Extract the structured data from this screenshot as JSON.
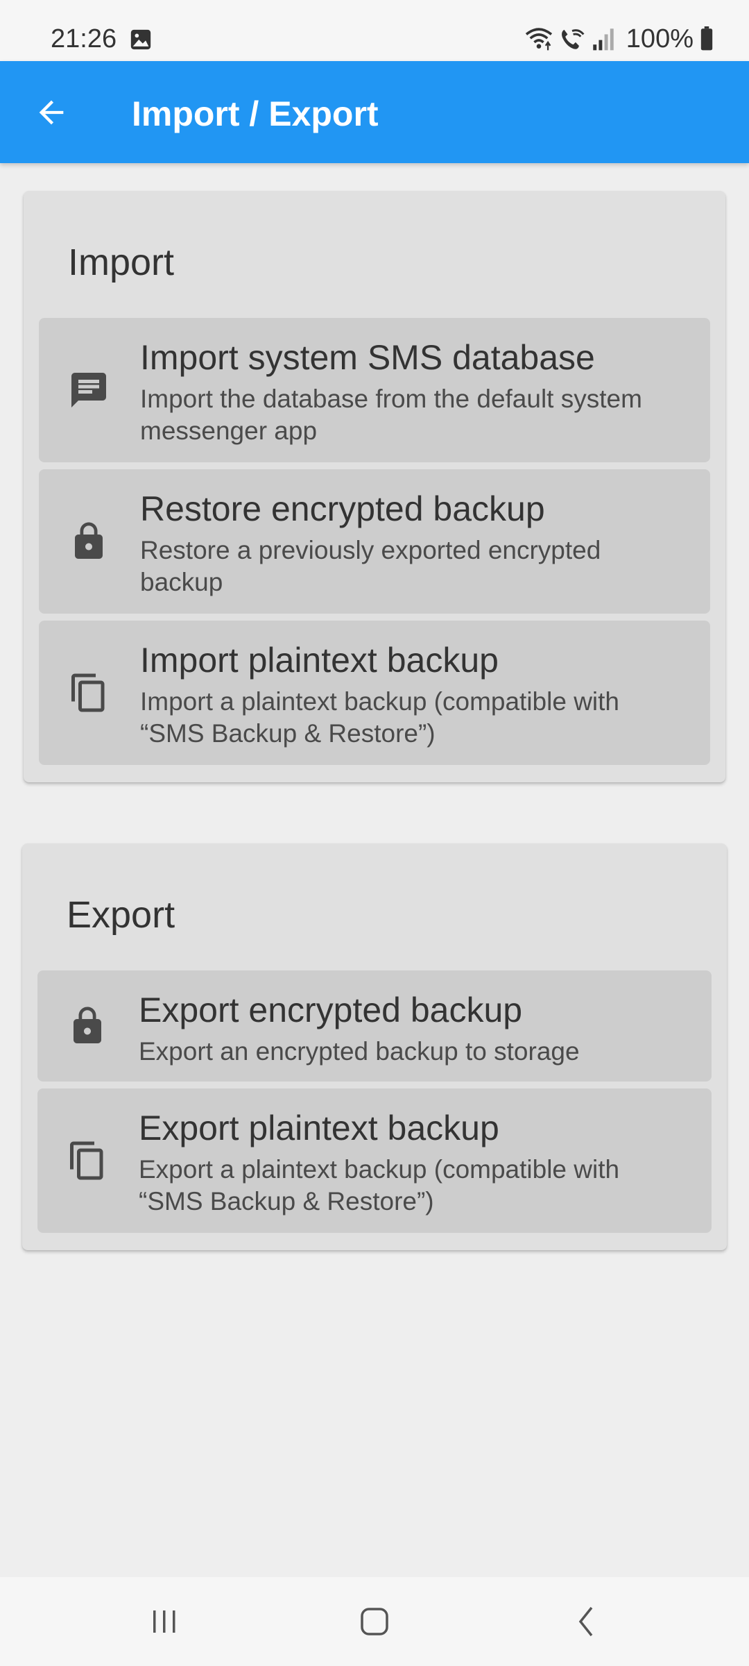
{
  "status_bar": {
    "time": "21:26",
    "battery_text": "100%",
    "icons": [
      "gallery-icon",
      "wifi-icon",
      "wifi-call-icon",
      "signal-icon",
      "battery-icon"
    ]
  },
  "app_bar": {
    "title": "Import / Export",
    "back_icon": "arrow-back-icon",
    "color": "#2196f3"
  },
  "import_section": {
    "title": "Import",
    "items": [
      {
        "title": "Import system SMS database",
        "subtitle": "Import the database from the default system messenger app",
        "icon": "message-icon"
      },
      {
        "title": "Restore encrypted backup",
        "subtitle": "Restore a previously exported encrypted backup",
        "icon": "lock-icon"
      },
      {
        "title": "Import plaintext backup",
        "subtitle": "Import a plaintext backup (compatible with “SMS Backup & Restore”)",
        "icon": "copy-icon"
      }
    ]
  },
  "export_section": {
    "title": "Export",
    "items": [
      {
        "title": "Export encrypted backup",
        "subtitle": "Export an encrypted backup to storage",
        "icon": "lock-icon"
      },
      {
        "title": "Export plaintext backup",
        "subtitle": "Export a plaintext backup (compatible with “SMS Backup & Restore”)",
        "icon": "copy-icon"
      }
    ]
  },
  "nav_bar": {
    "buttons": [
      "recents-button",
      "home-button",
      "back-nav-button"
    ]
  }
}
